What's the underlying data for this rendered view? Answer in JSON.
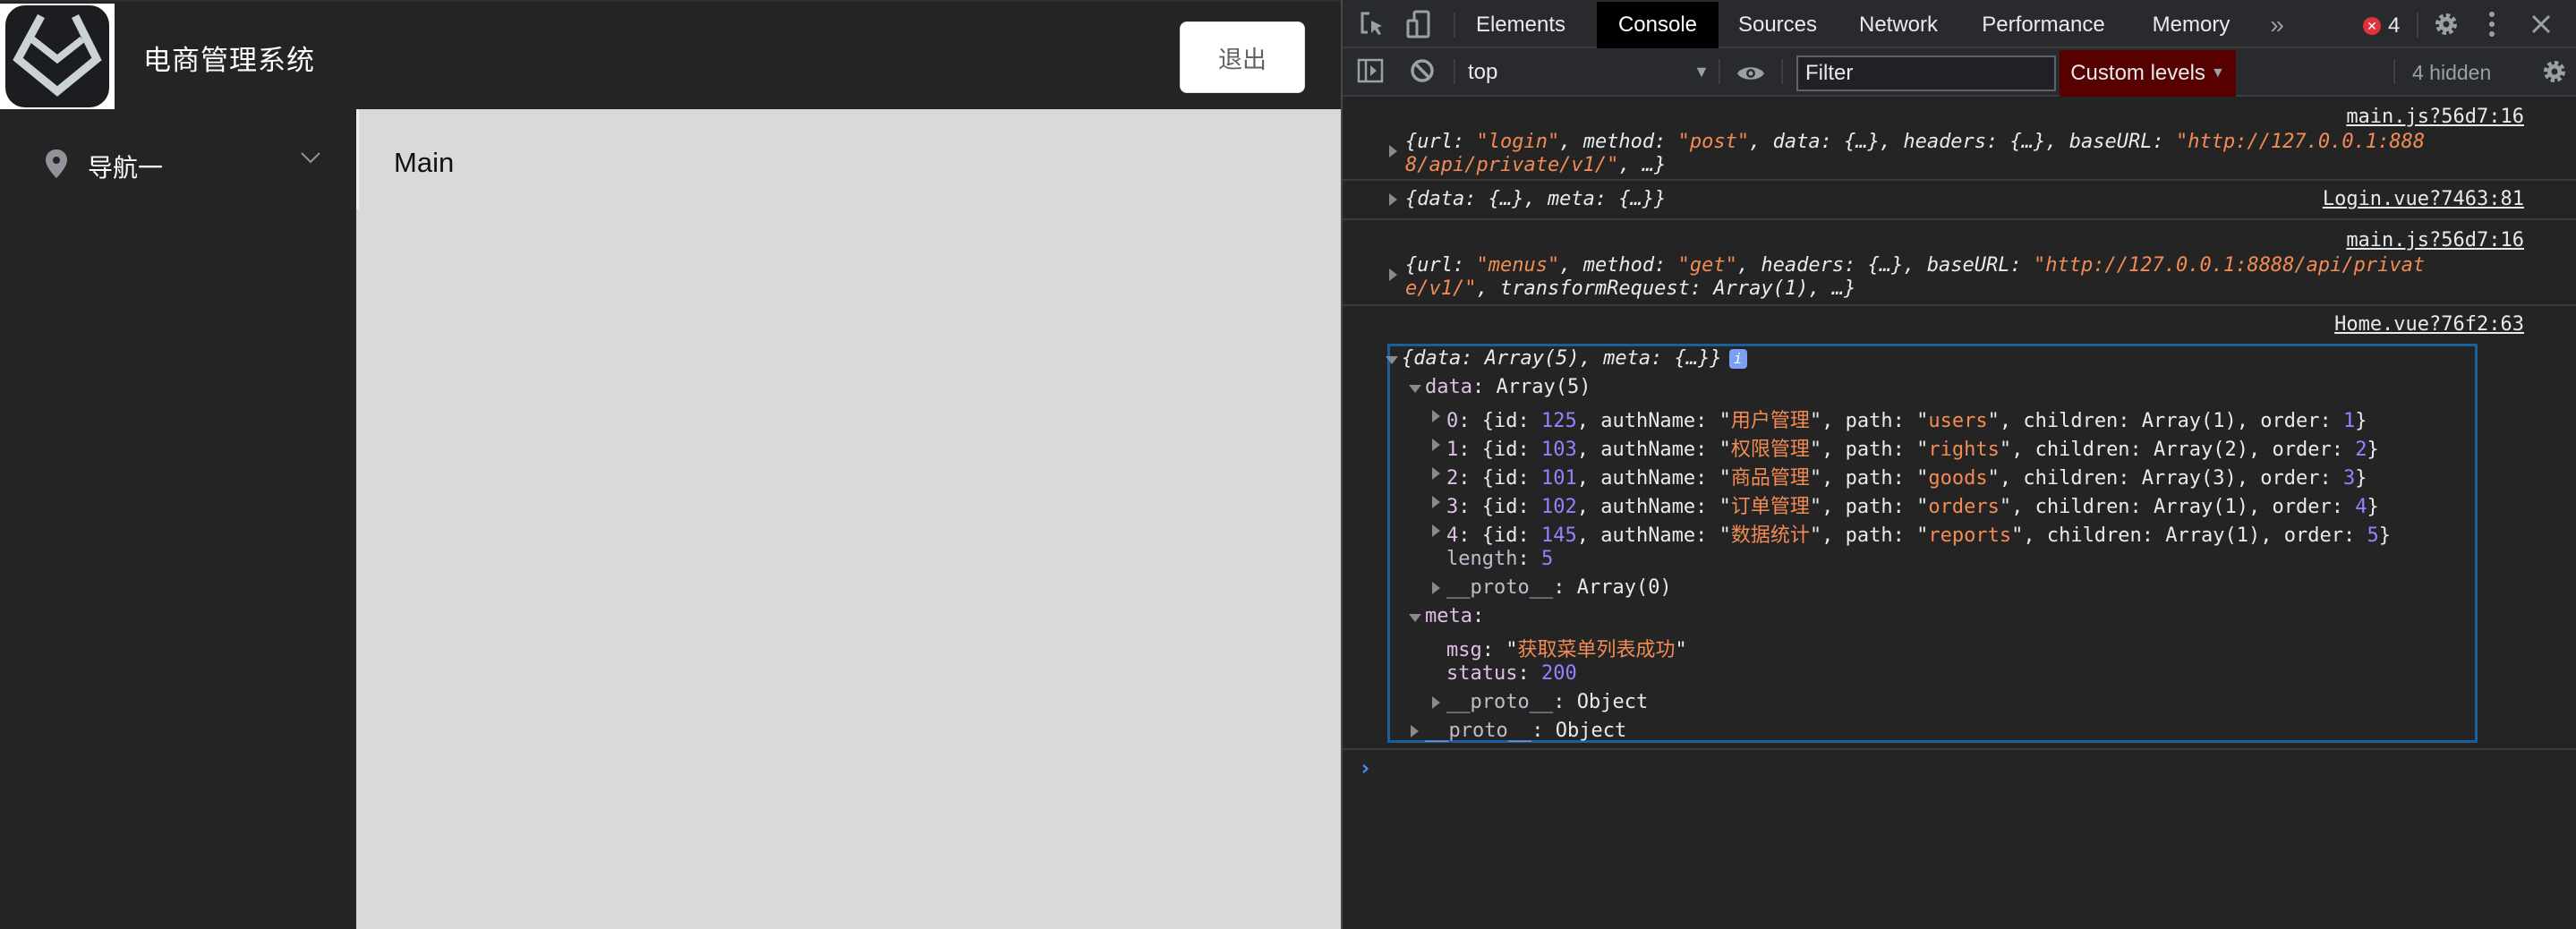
{
  "app": {
    "title": "电商管理系统",
    "logout_label": "退出",
    "sidebar": {
      "items": [
        {
          "label": "导航一",
          "icon": "location-icon",
          "expanded": false
        }
      ]
    },
    "main": {
      "text": "Main"
    },
    "colors": {
      "header_bg": "#242424",
      "main_bg": "#d9d9d9",
      "button_bg": "#ffffff"
    }
  },
  "devtools": {
    "tabs": [
      {
        "label": "Elements",
        "active": false
      },
      {
        "label": "Console",
        "active": true
      },
      {
        "label": "Sources",
        "active": false
      },
      {
        "label": "Network",
        "active": false
      },
      {
        "label": "Performance",
        "active": false
      },
      {
        "label": "Memory",
        "active": false
      }
    ],
    "more_tabs_icon": "»",
    "error_count": "4",
    "toolbar": {
      "context": "top",
      "filter_placeholder": "Filter",
      "levels_label": "Custom levels",
      "hidden_label": "4 hidden"
    },
    "console": {
      "messages": [
        {
          "source": "main.js?56d7:16",
          "line1_parts": [
            "{url: ",
            "\"login\"",
            ", method: ",
            "\"post\"",
            ", data: {…}, headers: {…}, baseURL: ",
            "\"http://127.0.0.1:888"
          ],
          "line2_parts": [
            "8/api/private/v1/\"",
            ", …}"
          ]
        },
        {
          "source": "Login.vue?7463:81",
          "line1": "{data: {…}, meta: {…}}"
        },
        {
          "source": "main.js?56d7:16",
          "line1_parts": [
            "{url: ",
            "\"menus\"",
            ", method: ",
            "\"get\"",
            ", headers: {…}, baseURL: ",
            "\"http://127.0.0.1:8888/api/privat"
          ],
          "line2_parts": [
            "e/v1/\"",
            ", transformRequest: Array(1), …}"
          ]
        },
        {
          "source": "Home.vue?76f2:63",
          "summary": "{data: Array(5), meta: {…}}",
          "data_label": "data: Array(5)",
          "items": [
            {
              "index": "0",
              "id": "125",
              "authName": "用户管理",
              "path": "users",
              "children": "Array(1)",
              "order": "1"
            },
            {
              "index": "1",
              "id": "103",
              "authName": "权限管理",
              "path": "rights",
              "children": "Array(2)",
              "order": "2"
            },
            {
              "index": "2",
              "id": "101",
              "authName": "商品管理",
              "path": "goods",
              "children": "Array(3)",
              "order": "3"
            },
            {
              "index": "3",
              "id": "102",
              "authName": "订单管理",
              "path": "orders",
              "children": "Array(1)",
              "order": "4"
            },
            {
              "index": "4",
              "id": "145",
              "authName": "数据统计",
              "path": "reports",
              "children": "Array(1)",
              "order": "5"
            }
          ],
          "length": "5",
          "data_proto": "Array(0)",
          "meta": {
            "msg": "获取菜单列表成功",
            "status": "200",
            "proto": "Object"
          },
          "root_proto": "Object"
        }
      ],
      "prompt": "›"
    }
  }
}
